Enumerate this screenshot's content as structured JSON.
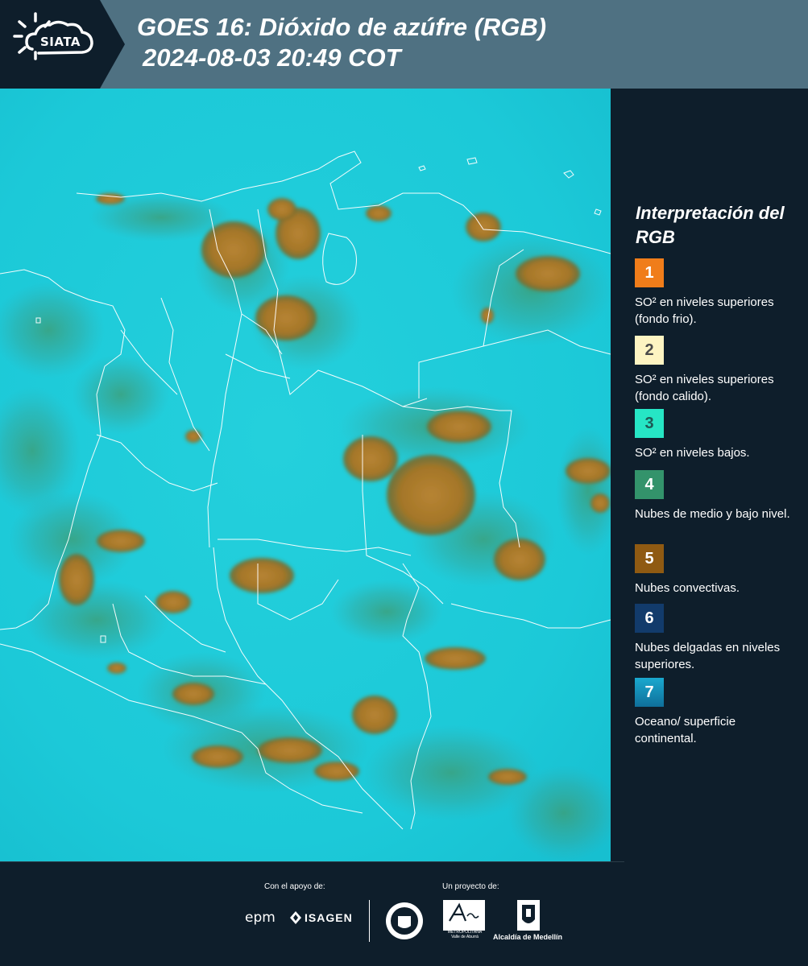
{
  "header": {
    "logo_text": "SIATA",
    "title_line1": "GOES 16: Dióxido de azúfre (RGB)",
    "title_line2": "2024-08-03 20:49 COT"
  },
  "legend": {
    "title": "Interpretación del RGB",
    "items": [
      {
        "number": "1",
        "label": "SO² en niveles superiores (fondo frio).",
        "color": "#f07d1a"
      },
      {
        "number": "2",
        "label": "SO² en niveles superiores (fondo calido).",
        "color": "#fdf4c2"
      },
      {
        "number": "3",
        "label": "SO² en niveles bajos.",
        "color": "#26e6c5"
      },
      {
        "number": "4",
        "label": "Nubes de medio y bajo nivel.",
        "color": "#33936b"
      },
      {
        "number": "5",
        "label": "Nubes convectivas.",
        "color": "#8f5a12"
      },
      {
        "number": "6",
        "label": "Nubes delgadas en niveles superiores.",
        "color": "#123b6b"
      },
      {
        "number": "7",
        "label": "Oceano/ superficie continental.",
        "color": "#1483b0"
      }
    ]
  },
  "footer": {
    "support_label": "Con el apoyo de:",
    "project_label": "Un proyecto de:",
    "sponsor_epm": "epm",
    "sponsor_isagen": "ISAGEN",
    "partner_area": "Área",
    "partner_area_sub": "METROPOLITANA Valle de Aburrá",
    "partner_alcaldia": "Alcaldía de Medellín"
  }
}
